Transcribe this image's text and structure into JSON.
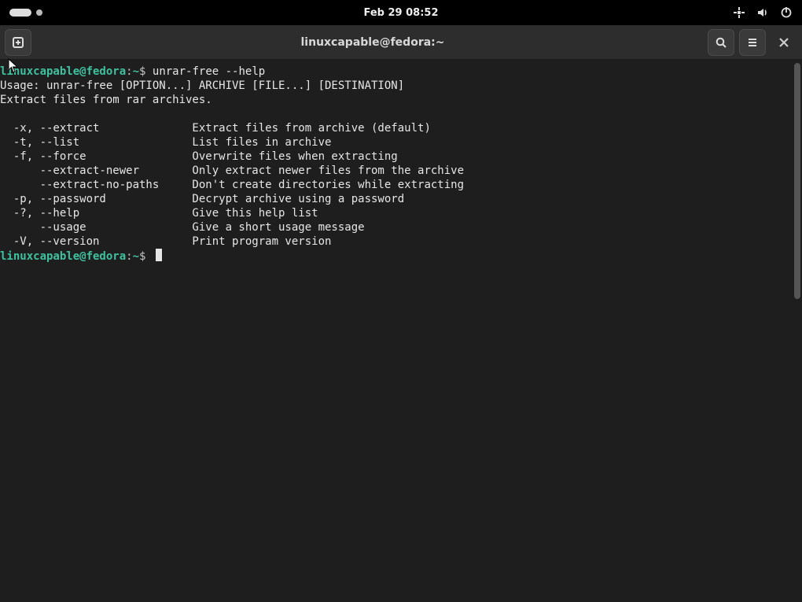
{
  "topbar": {
    "clock": "Feb 29  08:52"
  },
  "titlebar": {
    "title": "linuxcapable@fedora:~"
  },
  "terminal": {
    "prompt_user": "linuxcapable@fedora",
    "prompt_sep": ":",
    "prompt_path": "~",
    "prompt_symbol": "$",
    "command1": "unrar-free --help",
    "usage_line": "Usage: unrar-free [OPTION...] ARCHIVE [FILE...] [DESTINATION]",
    "desc_line": "Extract files from rar archives.",
    "options": [
      {
        "flags": "  -x, --extract",
        "desc": "Extract files from archive (default)"
      },
      {
        "flags": "  -t, --list",
        "desc": "List files in archive"
      },
      {
        "flags": "  -f, --force",
        "desc": "Overwrite files when extracting"
      },
      {
        "flags": "      --extract-newer",
        "desc": "Only extract newer files from the archive"
      },
      {
        "flags": "      --extract-no-paths",
        "desc": "Don't create directories while extracting"
      },
      {
        "flags": "  -p, --password",
        "desc": "Decrypt archive using a password"
      },
      {
        "flags": "  -?, --help",
        "desc": "Give this help list"
      },
      {
        "flags": "      --usage",
        "desc": "Give a short usage message"
      },
      {
        "flags": "  -V, --version",
        "desc": "Print program version"
      }
    ],
    "flag_col_width": 29
  }
}
